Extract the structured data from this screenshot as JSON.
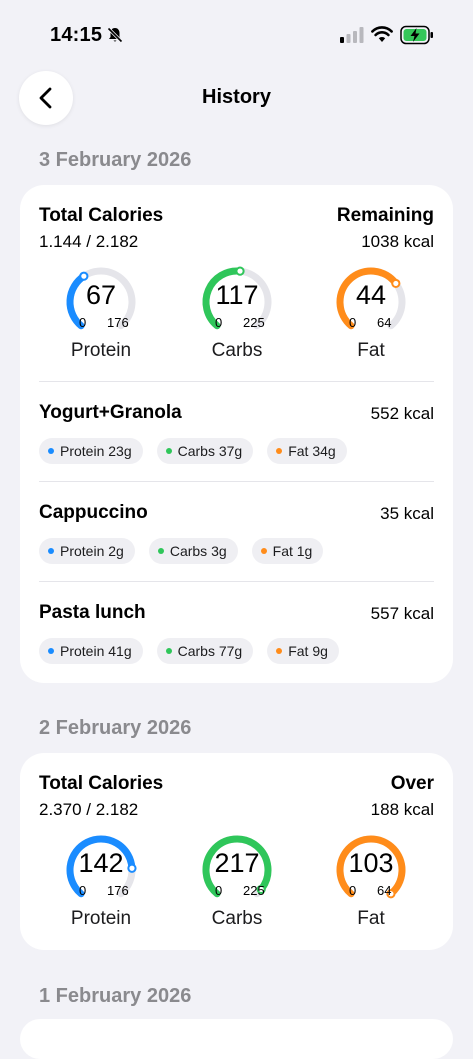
{
  "status_bar": {
    "time": "14:15"
  },
  "nav": {
    "title": "History"
  },
  "colors": {
    "protein": "#1a8cff",
    "carbs": "#2fc65a",
    "fat": "#ff8c1a",
    "track": "#e5e5ea"
  },
  "days": [
    {
      "date": "3 February 2026",
      "total_label": "Total Calories",
      "calories": "1.144 / 2.182",
      "status_label": "Remaining",
      "status_kcal": "1038 kcal",
      "macros": [
        {
          "name": "Protein",
          "value": "67",
          "min": "0",
          "max": "176",
          "fraction": 0.38
        },
        {
          "name": "Carbs",
          "value": "117",
          "min": "0",
          "max": "225",
          "fraction": 0.52
        },
        {
          "name": "Fat",
          "value": "44",
          "min": "0",
          "max": "64",
          "fraction": 0.69
        }
      ],
      "meals": [
        {
          "name": "Yogurt+Granola",
          "kcal": "552 kcal",
          "protein": "Protein 23g",
          "carbs": "Carbs 37g",
          "fat": "Fat 34g"
        },
        {
          "name": "Cappuccino",
          "kcal": "35 kcal",
          "protein": "Protein 2g",
          "carbs": "Carbs 3g",
          "fat": "Fat 1g"
        },
        {
          "name": "Pasta lunch",
          "kcal": "557 kcal",
          "protein": "Protein 41g",
          "carbs": "Carbs 77g",
          "fat": "Fat 9g"
        }
      ]
    },
    {
      "date": "2 February 2026",
      "total_label": "Total Calories",
      "calories": "2.370 / 2.182",
      "status_label": "Over",
      "status_kcal": "188 kcal",
      "macros": [
        {
          "name": "Protein",
          "value": "142",
          "min": "0",
          "max": "176",
          "fraction": 0.81
        },
        {
          "name": "Carbs",
          "value": "217",
          "min": "0",
          "max": "225",
          "fraction": 0.96
        },
        {
          "name": "Fat",
          "value": "103",
          "min": "0",
          "max": "64",
          "fraction": 1.0
        }
      ]
    },
    {
      "date": "1 February 2026"
    }
  ]
}
